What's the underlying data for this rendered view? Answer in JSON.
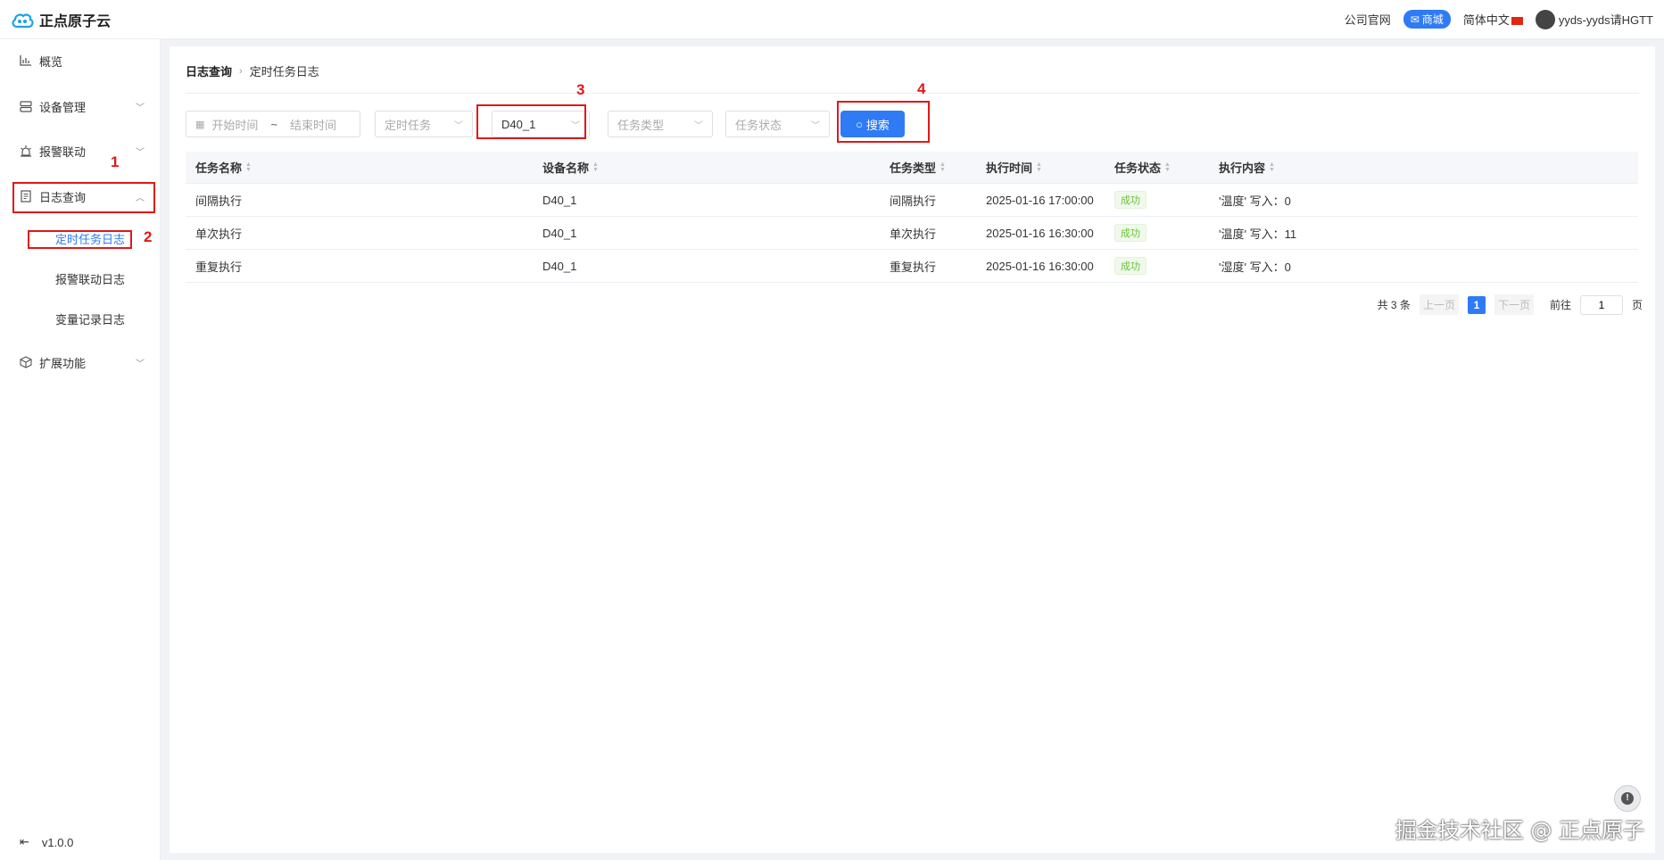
{
  "header": {
    "logo_text": "正点原子云",
    "company_site": "公司官网",
    "shop": "商城",
    "language": "简体中文",
    "username": "yyds-yyds请HGTT"
  },
  "sidebar": {
    "items": [
      {
        "label": "概览",
        "icon": "bar-chart-icon"
      },
      {
        "label": "设备管理",
        "icon": "device-icon"
      },
      {
        "label": "报警联动",
        "icon": "alarm-icon"
      },
      {
        "label": "日志查询",
        "icon": "log-icon"
      },
      {
        "label": "扩展功能",
        "icon": "extension-icon"
      }
    ],
    "sub_items": [
      "定时任务日志",
      "报警联动日志",
      "变量记录日志"
    ],
    "version": "v1.0.0"
  },
  "breadcrumb": {
    "first": "日志查询",
    "current": "定时任务日志"
  },
  "filters": {
    "start_time": "开始时间",
    "range_sep": "~",
    "end_time": "结束时间",
    "timed_task": "定时任务",
    "device": "D40_1",
    "task_type": "任务类型",
    "task_status": "任务状态",
    "search": "搜索"
  },
  "table": {
    "headers": [
      "任务名称",
      "设备名称",
      "任务类型",
      "执行时间",
      "任务状态",
      "执行内容"
    ],
    "rows": [
      [
        "间隔执行",
        "D40_1",
        "间隔执行",
        "2025-01-16 17:00:00",
        "成功",
        "'温度' 写入：0"
      ],
      [
        "单次执行",
        "D40_1",
        "单次执行",
        "2025-01-16 16:30:00",
        "成功",
        "'温度' 写入：11"
      ],
      [
        "重复执行",
        "D40_1",
        "重复执行",
        "2025-01-16 16:30:00",
        "成功",
        "'湿度' 写入：0"
      ]
    ]
  },
  "pagination": {
    "total": "共 3 条",
    "prev": "上一页",
    "page": "1",
    "next": "下一页",
    "goto": "前往",
    "goto_value": "1",
    "page_unit": "页"
  },
  "annotations": [
    "1",
    "2",
    "3",
    "4"
  ],
  "watermark": "掘金技术社区 @ 正点原子",
  "colors": {
    "accent": "#2f7bf5",
    "annotation": "#e01818",
    "success": "#67c23a"
  }
}
